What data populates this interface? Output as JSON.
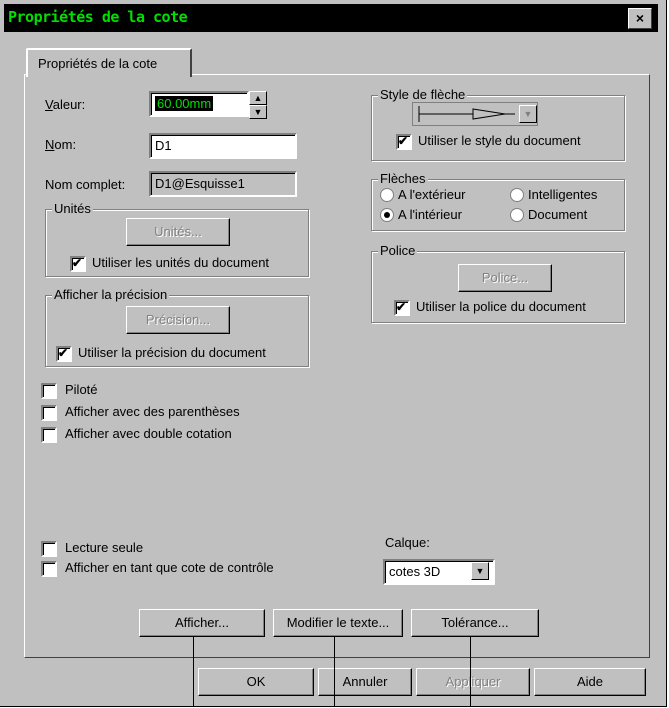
{
  "window": {
    "title": "Propriétés de la cote",
    "close_label": "×"
  },
  "tab": {
    "label": "Propriétés de la cote"
  },
  "fields": {
    "valeur_label": "Valeur:",
    "valeur_value": "60.00mm",
    "nom_label": "Nom:",
    "nom_value": "D1",
    "nom_complet_label": "Nom complet:",
    "nom_complet_value": "D1@Esquisse1"
  },
  "unites": {
    "title": "Unités",
    "button": "Unités...",
    "checkbox": "Utiliser les unités du document",
    "checked": true
  },
  "precision": {
    "title": "Afficher la précision",
    "button": "Précision...",
    "checkbox": "Utiliser la précision du document",
    "checked": true
  },
  "options": [
    {
      "label": "Piloté",
      "checked": false
    },
    {
      "label": "Afficher avec des parenthèses",
      "checked": false
    },
    {
      "label": "Afficher avec double cotation",
      "checked": false
    }
  ],
  "style_fleche": {
    "title": "Style de flèche",
    "checkbox": "Utiliser le style du document",
    "checked": true
  },
  "fleches": {
    "title": "Flèches",
    "radios": [
      {
        "label": "A l'extérieur",
        "selected": false
      },
      {
        "label": "Intelligentes",
        "selected": false
      },
      {
        "label": "A l'intérieur",
        "selected": true
      },
      {
        "label": "Document",
        "selected": false
      }
    ]
  },
  "police": {
    "title": "Police",
    "button": "Police...",
    "checkbox": "Utiliser la police du document",
    "checked": true
  },
  "bottom_options": [
    {
      "label": "Lecture seule",
      "checked": false
    },
    {
      "label": "Afficher en tant que cote de contrôle",
      "checked": false
    }
  ],
  "calque": {
    "label": "Calque:",
    "value": "cotes 3D"
  },
  "action_buttons": {
    "afficher": "Afficher...",
    "modifier": "Modifier le texte...",
    "tolerance": "Tolérance..."
  },
  "dialog_buttons": {
    "ok": "OK",
    "annuler": "Annuler",
    "appliquer": "Appliquer",
    "aide": "Aide"
  },
  "colors": {
    "title_text": "#00e000",
    "title_bg": "#000000",
    "value_bg": "#000000",
    "value_text": "#00e000",
    "face": "#c0c0c0"
  }
}
